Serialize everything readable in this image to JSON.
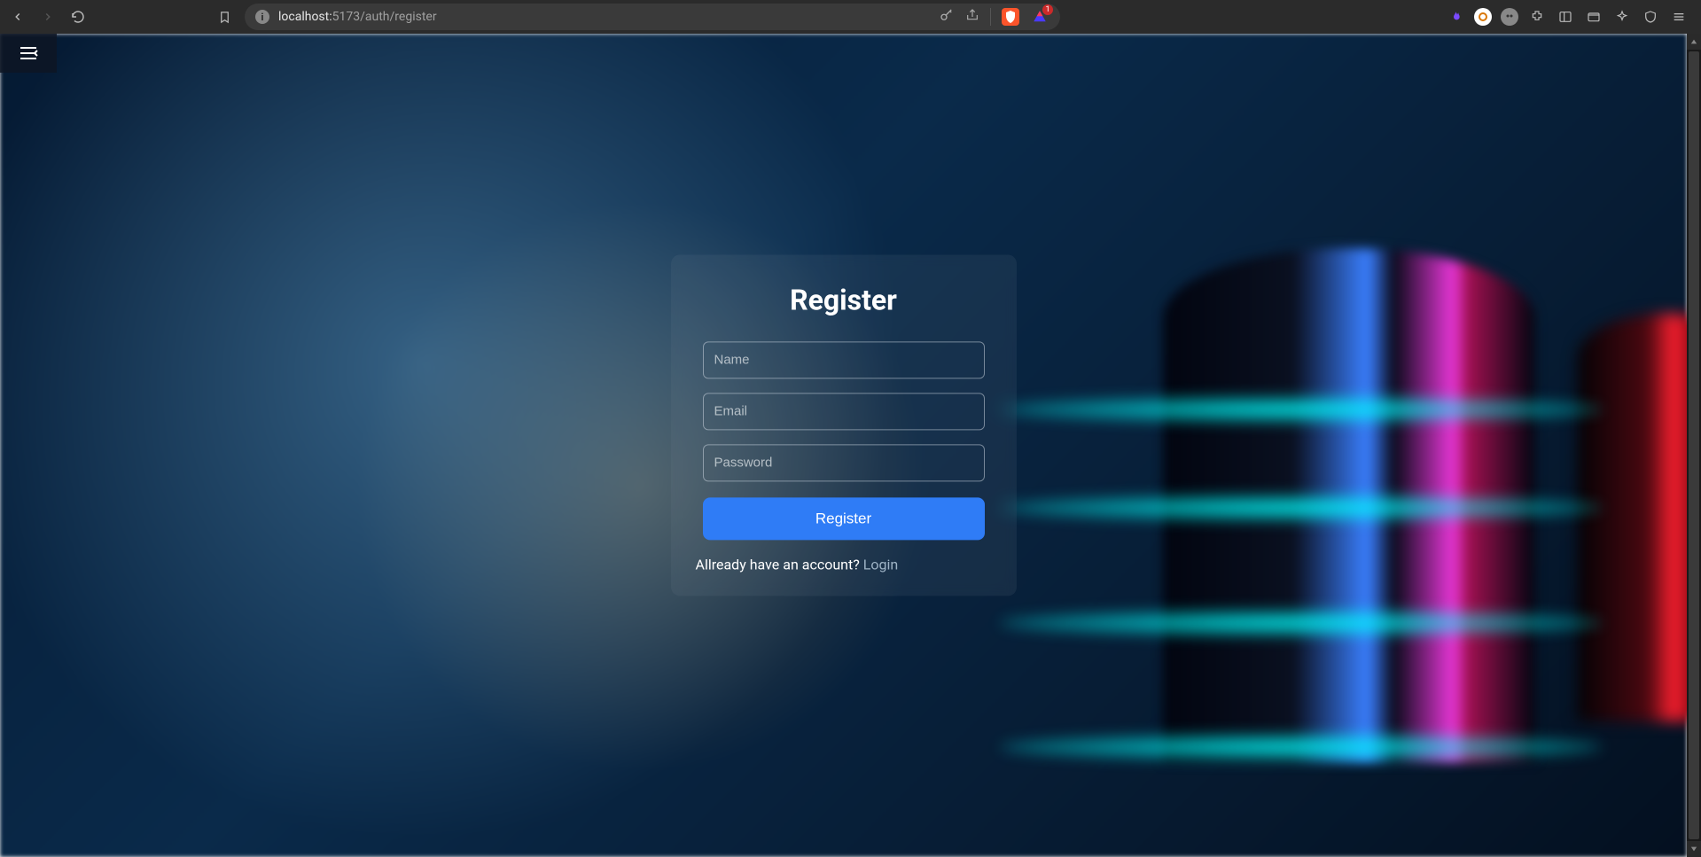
{
  "browser": {
    "url_host": "localhost:",
    "url_port_path": "5173/auth/register",
    "badge_count": "1"
  },
  "form": {
    "title": "Register",
    "name_placeholder": "Name",
    "email_placeholder": "Email",
    "password_placeholder": "Password",
    "submit_label": "Register",
    "footer_prompt": "Allready have an account? ",
    "footer_link": "Login"
  }
}
